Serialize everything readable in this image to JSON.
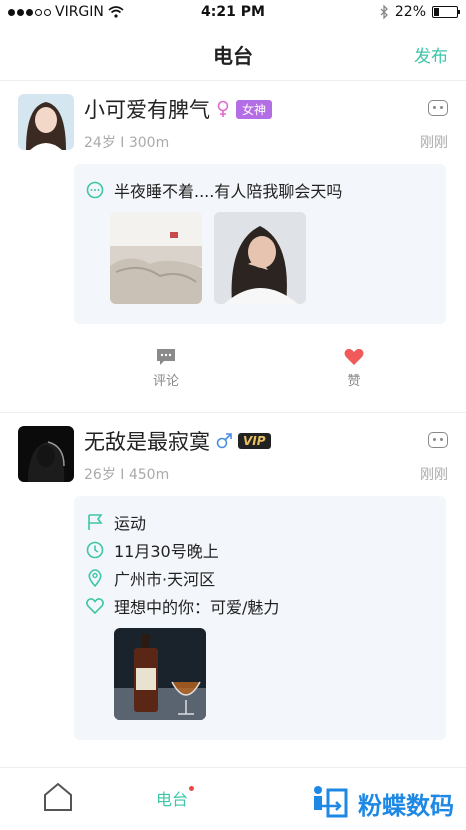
{
  "status_bar": {
    "carrier": "VIRGIN",
    "time": "4:21 PM",
    "battery_percent": "22%",
    "battery_level": 0.22
  },
  "nav": {
    "title": "电台",
    "publish_label": "发布"
  },
  "posts": [
    {
      "user_name": "小可爱有脾气",
      "gender_icon": "female-icon",
      "badge": "女神",
      "meta": "24岁 I 300m",
      "time": "刚刚",
      "content": {
        "text": "半夜睡不着....有人陪我聊会天吗",
        "photos": [
          "bedroom-photo",
          "girl-photo"
        ]
      },
      "actions": {
        "comment_label": "评论",
        "like_label": "赞"
      }
    },
    {
      "user_name": "无敌是最寂寞",
      "gender_icon": "male-icon",
      "badge": "VIP",
      "meta": "26岁 I 450m",
      "time": "刚刚",
      "content": {
        "activity": "运动",
        "when": "11月30号晚上",
        "location": "广州市·天河区",
        "ideal": "理想中的你：可爱/魅力",
        "photos": [
          "whiskey-photo"
        ]
      }
    }
  ],
  "tab_bar": {
    "active_label": "电台",
    "watermark": "粉蝶数码"
  },
  "colors": {
    "accent": "#3ec6a8",
    "like_red": "#f05a5a",
    "goddess_purple": "#b36ee5",
    "watermark_blue": "#1e88e5"
  }
}
